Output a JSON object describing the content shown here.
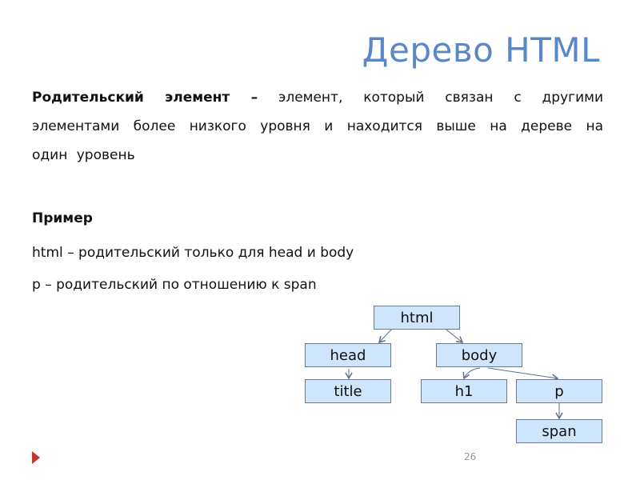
{
  "slide": {
    "title": "Дерево HTML",
    "definition": {
      "term": "Родительский элемент –",
      "text": " элемент, который связан с другими элементами более низкого уровня и находится выше на дереве на один уровень"
    },
    "example": {
      "heading": "Пример",
      "lines": [
        "html – родительский только для head и body",
        "p – родительский по отношению к span"
      ]
    },
    "tree": {
      "nodes": {
        "html": "html",
        "head": "head",
        "body": "body",
        "title": "title",
        "h1": "h1",
        "p": "p",
        "span": "span"
      },
      "edges": [
        [
          "html",
          "head"
        ],
        [
          "html",
          "body"
        ],
        [
          "head",
          "title"
        ],
        [
          "body",
          "h1"
        ],
        [
          "body",
          "p"
        ],
        [
          "p",
          "span"
        ]
      ]
    },
    "page_number": "26",
    "colors": {
      "title": "#5a87c5",
      "node_fill": "#cfe5fb",
      "node_border": "#6a7a96",
      "nav_arrow": "#c0392b"
    }
  }
}
